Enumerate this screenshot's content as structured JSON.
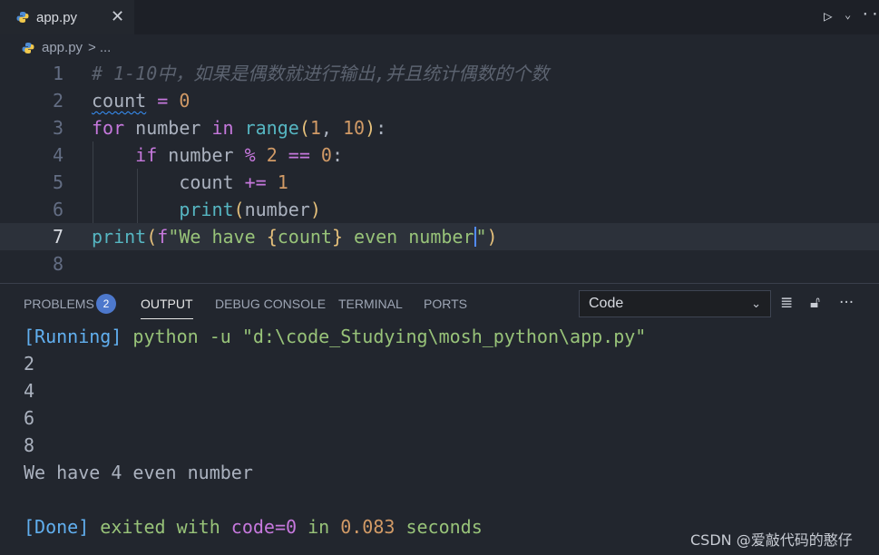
{
  "tab": {
    "filename": "app.py",
    "close": "✕"
  },
  "toolbar": {
    "run_glyph": "▷",
    "chevron": "⌄",
    "more": "···"
  },
  "breadcrumb": {
    "file": "app.py",
    "separator": ">",
    "more": "..."
  },
  "editor": {
    "line_numbers": [
      "1",
      "2",
      "3",
      "4",
      "5",
      "6",
      "7",
      "8"
    ],
    "active_line": 7,
    "code_lines": [
      [
        {
          "t": "# 1-10中，如果是偶数就进行输出,并且统计偶数的个数",
          "c": "cm"
        }
      ],
      [
        {
          "t": "count",
          "c": "squiggle"
        },
        {
          "t": " "
        },
        {
          "t": "=",
          "c": "op"
        },
        {
          "t": " "
        },
        {
          "t": "0",
          "c": "num"
        }
      ],
      [
        {
          "t": "for",
          "c": "kw"
        },
        {
          "t": " number "
        },
        {
          "t": "in",
          "c": "kw"
        },
        {
          "t": " "
        },
        {
          "t": "range",
          "c": "bi"
        },
        {
          "t": "(",
          "c": "br1"
        },
        {
          "t": "1",
          "c": "num"
        },
        {
          "t": ", "
        },
        {
          "t": "10",
          "c": "num"
        },
        {
          "t": ")",
          "c": "br1"
        },
        {
          "t": ":"
        }
      ],
      [
        {
          "t": "    "
        },
        {
          "t": "if",
          "c": "kw"
        },
        {
          "t": " number "
        },
        {
          "t": "%",
          "c": "op"
        },
        {
          "t": " "
        },
        {
          "t": "2",
          "c": "num"
        },
        {
          "t": " "
        },
        {
          "t": "==",
          "c": "op"
        },
        {
          "t": " "
        },
        {
          "t": "0",
          "c": "num"
        },
        {
          "t": ":"
        }
      ],
      [
        {
          "t": "        count "
        },
        {
          "t": "+=",
          "c": "op"
        },
        {
          "t": " "
        },
        {
          "t": "1",
          "c": "num"
        }
      ],
      [
        {
          "t": "        "
        },
        {
          "t": "print",
          "c": "bi"
        },
        {
          "t": "(",
          "c": "br1"
        },
        {
          "t": "number"
        },
        {
          "t": ")",
          "c": "br1"
        }
      ],
      [
        {
          "t": "print",
          "c": "bi"
        },
        {
          "t": "(",
          "c": "br1"
        },
        {
          "t": "f",
          "c": "kw"
        },
        {
          "t": "\"We have ",
          "c": "str"
        },
        {
          "t": "{",
          "c": "br1"
        },
        {
          "t": "count",
          "c": "str"
        },
        {
          "t": "}",
          "c": "br1"
        },
        {
          "t": " even number",
          "c": "str"
        },
        {
          "t": "CURSOR"
        },
        {
          "t": "\"",
          "c": "str"
        },
        {
          "t": ")",
          "c": "br1"
        }
      ],
      []
    ]
  },
  "panel": {
    "tabs": [
      "PROBLEMS",
      "OUTPUT",
      "DEBUG CONSOLE",
      "TERMINAL",
      "PORTS"
    ],
    "active_tab": "OUTPUT",
    "problems_count": "2",
    "channel_select": "Code",
    "output_lines": [
      [
        {
          "t": "[Running]",
          "c": "o-blue"
        },
        {
          "t": " python -u \"d:\\code_Studying\\mosh_python\\app.py\"",
          "c": "o-green"
        }
      ],
      [
        {
          "t": "2"
        }
      ],
      [
        {
          "t": "4"
        }
      ],
      [
        {
          "t": "6"
        }
      ],
      [
        {
          "t": "8"
        }
      ],
      [
        {
          "t": "We have 4 even number"
        }
      ],
      [],
      [
        {
          "t": "[Done]",
          "c": "o-blue"
        },
        {
          "t": " exited with ",
          "c": "o-green"
        },
        {
          "t": "code=0",
          "c": "o-purple"
        },
        {
          "t": " in ",
          "c": "o-green"
        },
        {
          "t": "0.083",
          "c": "o-orange"
        },
        {
          "t": " seconds",
          "c": "o-green"
        }
      ]
    ]
  },
  "watermark": "CSDN @爱敲代码的憨仔"
}
